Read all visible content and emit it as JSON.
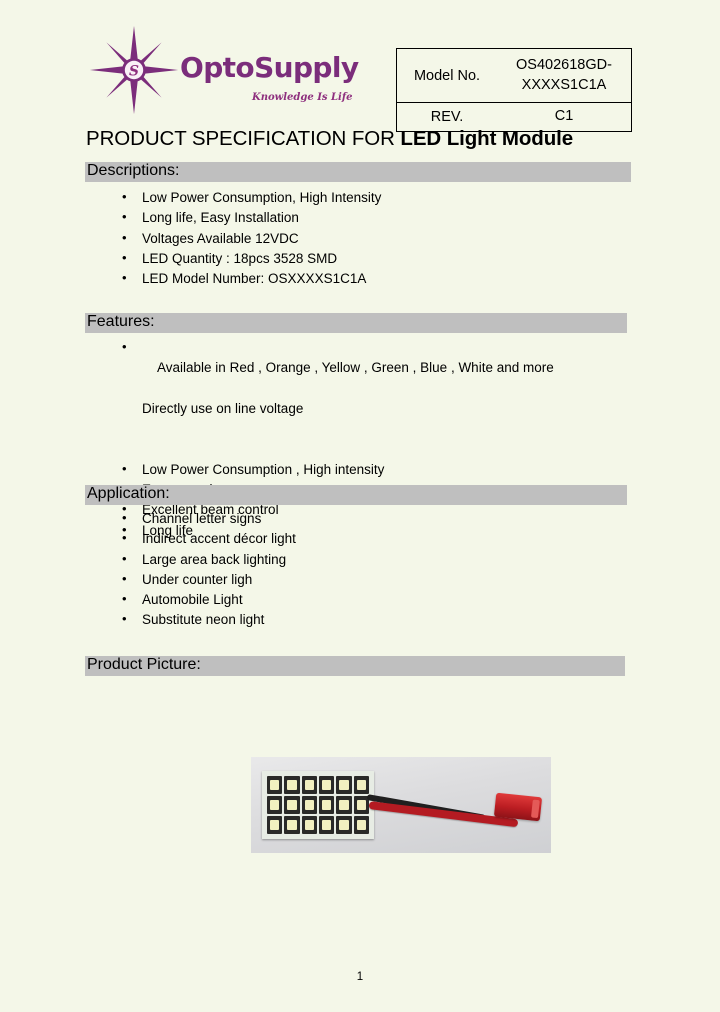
{
  "page": {
    "background_color": "#f4f7e8",
    "bar_color": "#bfbfbf",
    "brand_color": "#7b2d7b",
    "page_number": "1"
  },
  "header": {
    "logo": {
      "icon": "eight-point-star-logo",
      "monogram": "S",
      "wordmark": "OptoSupply",
      "tagline": "Knowledge Is Life"
    },
    "model_table": {
      "model_label": "Model No.",
      "model_value_line1": "OS402618GD-",
      "model_value_line2": "XXXXS1C1A",
      "rev_label": "REV.",
      "rev_value": "C1"
    }
  },
  "document": {
    "title_regular": "PRODUCT SPECIFICATION FOR ",
    "title_bold": "LED Light  Module"
  },
  "sections": {
    "descriptions": {
      "heading": "Descriptions:",
      "items": [
        "Low Power Consumption, High Intensity",
        "Long life, Easy Installation",
        "Voltages Available 12VDC",
        "LED Quantity : 18pcs 3528 SMD",
        "LED Model Number: OSXXXXS1C1A"
      ]
    },
    "features": {
      "heading": "Features:",
      "items": [
        "Available in Red , Orange , Yellow , Green , Blue , White and more",
        "Low Power Consumption , High intensity",
        "Energy saving",
        "Excellent beam control",
        "Long life"
      ],
      "item0_continuation": "Directly use on line voltage"
    },
    "application": {
      "heading": "Application:",
      "items": [
        "Channel letter signs",
        "Indirect accent décor light",
        "Large area back lighting",
        "Under counter ligh",
        "Automobile Light",
        "Substitute neon light"
      ]
    },
    "product_picture": {
      "heading": "Product  Picture:",
      "photo_alt": "led-module-photo",
      "led_rows": 3,
      "led_columns": 6,
      "led_total": "18"
    }
  }
}
